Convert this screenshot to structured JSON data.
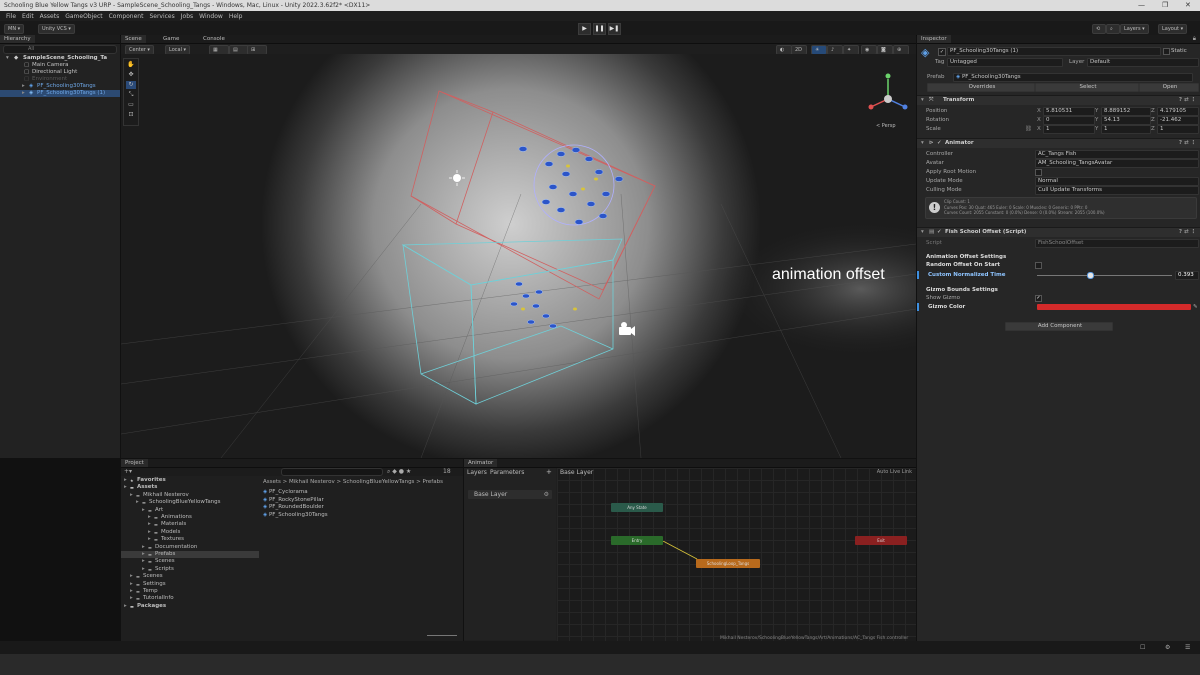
{
  "window": {
    "title": "Schooling Blue Yellow Tangs v3 URP - SampleScene_Schooling_Tangs - Windows, Mac, Linux - Unity 2022.3.62f2* <DX11>",
    "controls": [
      "—",
      "❐",
      "✕"
    ]
  },
  "menu": [
    "File",
    "Edit",
    "Assets",
    "GameObject",
    "Component",
    "Services",
    "Jobs",
    "Window",
    "Help"
  ],
  "toolbar": {
    "account": "MN ▾",
    "vcs": "Unity VCS ▾",
    "layers": "Layers ▾",
    "layout": "Layout ▾"
  },
  "hierarchy": {
    "tab": "Hierarchy",
    "search_placeholder": "All",
    "items": [
      {
        "label": "SampleScene_Schooling_Ta",
        "indent": 0
      },
      {
        "label": "Main Camera",
        "indent": 1
      },
      {
        "label": "Directional Light",
        "indent": 1
      },
      {
        "label": "Environment",
        "indent": 1
      },
      {
        "label": "PF_Schooling30Tangs",
        "indent": 1
      },
      {
        "label": "PF_Schooling30Tangs (1)",
        "indent": 1
      }
    ]
  },
  "scene": {
    "tabs": [
      "Scene",
      "Game",
      "Console"
    ],
    "pivot": "Center ▾",
    "space": "Local ▾",
    "persp_label": "< Persp",
    "overlay_caption": "animation offset"
  },
  "inspector": {
    "tab": "Inspector",
    "object_name": "PF_Schooling30Tangs (1)",
    "static_label": "Static",
    "tag_label": "Tag",
    "tag_value": "Untagged",
    "layer_label": "Layer",
    "layer_value": "Default",
    "prefab_label": "Prefab",
    "prefab_value": "PF_Schooling30Tangs",
    "overrides": "Overrides",
    "select": "Select",
    "open": "Open",
    "transform": {
      "title": "Transform",
      "position_label": "Position",
      "rotation_label": "Rotation",
      "scale_label": "Scale",
      "position": {
        "x": "5.810531",
        "y": "8.889152",
        "z": "4.179105"
      },
      "rotation": {
        "x": "0",
        "y": "54.13",
        "z": "-21.462"
      },
      "scale": {
        "x": "1",
        "y": "1",
        "z": "1"
      }
    },
    "animator": {
      "title": "Animator",
      "controller_label": "Controller",
      "controller_value": "AC_Tangs Fish",
      "avatar_label": "Avatar",
      "avatar_value": "AM_Schooling_TangsAvatar",
      "apply_root_label": "Apply Root Motion",
      "update_mode_label": "Update Mode",
      "update_mode_value": "Normal",
      "culling_label": "Culling Mode",
      "culling_value": "Cull Update Transforms",
      "info_line1": "Clip Count: 1",
      "info_line2": "Curves Pos: 30 Quat: 465 Euler: 0 Scale: 0 Muscles: 0 Generic: 0 PPtr: 0",
      "info_line3": "Curves Count: 2055 Constant: 0 (0.0%) Dense: 0 (0.0%) Stream: 2055 (100.0%)"
    },
    "fish_school": {
      "title": "Fish School Offset (Script)",
      "script_label": "Script",
      "script_value": "FishSchoolOffset",
      "section1": "Animation Offset Settings",
      "random_label": "Random Offset On Start",
      "custom_label": "Custom Normalized Time",
      "custom_value": "0.393",
      "custom_fraction": 0.393,
      "section2": "Gizmo Bounds Settings",
      "show_gizmo_label": "Show Gizmo",
      "gizmo_color_label": "Gizmo Color",
      "gizmo_color": "#d42a2a"
    },
    "add_component": "Add Component"
  },
  "project": {
    "tab": "Project",
    "count": "18",
    "breadcrumb": "Assets > Mikhail Nesterov > SchoolingBlueYellowTangs > Prefabs",
    "tree": [
      {
        "label": "Favorites",
        "indent": 0,
        "bold": true
      },
      {
        "label": "Assets",
        "indent": 0,
        "bold": true
      },
      {
        "label": "Mikhail Nesterov",
        "indent": 1
      },
      {
        "label": "SchoolingBlueYellowTangs",
        "indent": 2
      },
      {
        "label": "Art",
        "indent": 3
      },
      {
        "label": "Animations",
        "indent": 4
      },
      {
        "label": "Materials",
        "indent": 4
      },
      {
        "label": "Models",
        "indent": 4
      },
      {
        "label": "Textures",
        "indent": 4
      },
      {
        "label": "Documentation",
        "indent": 3
      },
      {
        "label": "Prefabs",
        "indent": 3,
        "selected": true
      },
      {
        "label": "Scenes",
        "indent": 3
      },
      {
        "label": "Scripts",
        "indent": 3
      },
      {
        "label": "Scenes",
        "indent": 1
      },
      {
        "label": "Settings",
        "indent": 1
      },
      {
        "label": "Temp",
        "indent": 1
      },
      {
        "label": "TutorialInfo",
        "indent": 1
      },
      {
        "label": "Packages",
        "indent": 0,
        "bold": true
      }
    ],
    "files": [
      "PF_Cyclorama",
      "PF_RockyStonePillar",
      "PF_RoundedBoulder",
      "PF_Schooling30Tangs"
    ]
  },
  "animator_window": {
    "tab": "Animator",
    "subtabs": [
      "Layers",
      "Parameters"
    ],
    "layer_title": "Base Layer",
    "layer_item": "Base Layer",
    "auto_live": "Auto Live Link",
    "nodes": {
      "any": "Any State",
      "entry": "Entry",
      "exit": "Exit",
      "state": "SchoolingLoop_Tangs"
    },
    "path": "Mikhail Nesterov/SchoolingBlueYellowTangs/Art/Animations/AC_Tangs Fish.controller"
  },
  "status_icons": [
    "☐",
    "⚙",
    "☰"
  ]
}
